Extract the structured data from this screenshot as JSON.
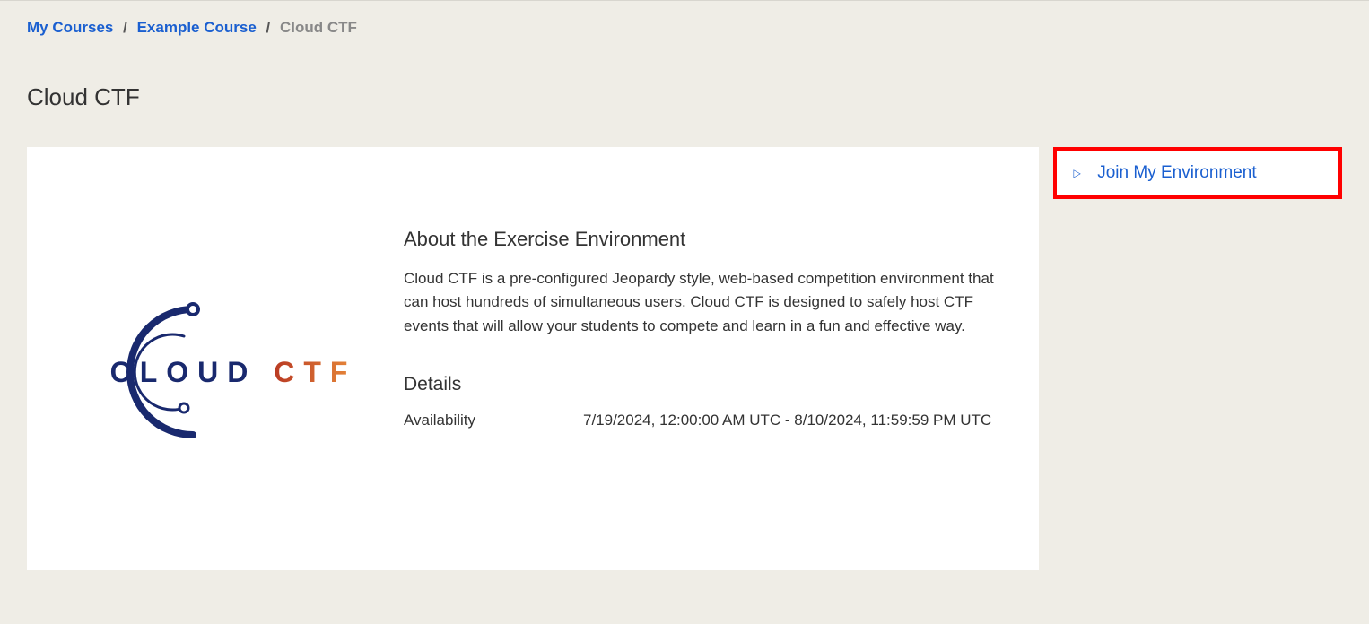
{
  "breadcrumb": {
    "items": [
      {
        "label": "My Courses",
        "link": true
      },
      {
        "label": "Example Course",
        "link": true
      },
      {
        "label": "Cloud CTF",
        "link": false
      }
    ]
  },
  "page": {
    "title": "Cloud CTF"
  },
  "logo": {
    "word1": "CLOUD",
    "word2": "CTF"
  },
  "about": {
    "heading": "About the Exercise Environment",
    "description": "Cloud CTF is a pre-configured Jeopardy style, web-based competition environment that can host hundreds of simultaneous users. Cloud CTF is designed to safely host CTF events that will allow your students to compete and learn in a fun and effective way."
  },
  "details": {
    "heading": "Details",
    "availability_label": "Availability",
    "availability_value": "7/19/2024, 12:00:00 AM UTC - 8/10/2024, 11:59:59 PM UTC"
  },
  "actions": {
    "join_label": "Join My Environment"
  }
}
